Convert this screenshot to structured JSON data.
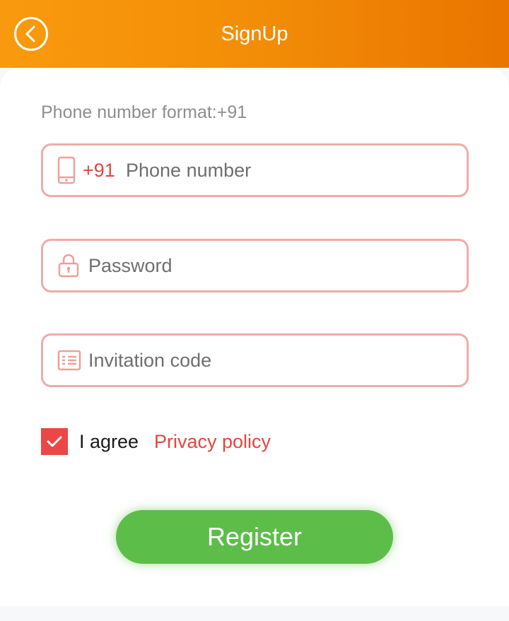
{
  "header": {
    "title": "SignUp",
    "back_icon": "chevron-left-circle-icon",
    "gradient": [
      "#f99a0e",
      "#ea7500"
    ]
  },
  "form": {
    "format_hint": "Phone number format:+91",
    "phone": {
      "prefix": "+91",
      "placeholder": "Phone number",
      "value": "",
      "icon": "mobile-phone-icon"
    },
    "password": {
      "placeholder": "Password",
      "value": "",
      "icon": "lock-icon"
    },
    "invitation": {
      "placeholder": "Invitation code",
      "value": "",
      "icon": "id-card-icon"
    },
    "agree": {
      "checked": true,
      "label": "I agree",
      "link_label": "Privacy policy"
    },
    "register_label": "Register"
  },
  "colors": {
    "accent_orange": "#f38d07",
    "field_border": "#eeaca8",
    "link_red": "#e2463f",
    "checkbox_red": "#ed4646",
    "register_green": "#5dbd49"
  }
}
